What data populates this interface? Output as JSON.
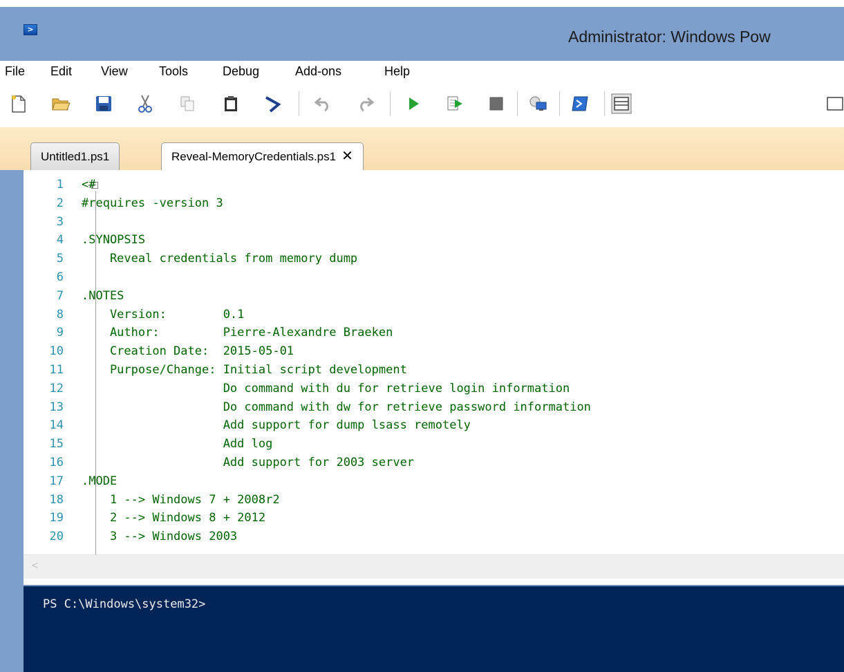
{
  "window": {
    "title": "Administrator: Windows Pow",
    "icon": "powershell-icon"
  },
  "menu": [
    "File",
    "Edit",
    "View",
    "Tools",
    "Debug",
    "Add-ons",
    "Help"
  ],
  "toolbar": {
    "icons": [
      "new-file-icon",
      "open-folder-icon",
      "save-icon",
      "cut-icon",
      "copy-icon",
      "paste-icon",
      "clear-console-icon",
      "undo-icon",
      "redo-icon",
      "run-script-icon",
      "run-selection-icon",
      "stop-icon",
      "remote-powershell-icon",
      "powershell-console-icon",
      "show-script-pane-top-icon",
      "show-script-pane-right-icon"
    ]
  },
  "tabs": [
    {
      "label": "Untitled1.ps1",
      "active": false
    },
    {
      "label": "Reveal-MemoryCredentials.ps1",
      "active": true,
      "close": "✕"
    }
  ],
  "editor": {
    "fold_marker": "−",
    "lines": [
      {
        "no": "1",
        "text": "<#"
      },
      {
        "no": "2",
        "text": "#requires -version 3"
      },
      {
        "no": "3",
        "text": ""
      },
      {
        "no": "4",
        "text": ".SYNOPSIS"
      },
      {
        "no": "5",
        "text": "    Reveal credentials from memory dump"
      },
      {
        "no": "6",
        "text": ""
      },
      {
        "no": "7",
        "text": ".NOTES"
      },
      {
        "no": "8",
        "text": "    Version:        0.1"
      },
      {
        "no": "9",
        "text": "    Author:         Pierre-Alexandre Braeken"
      },
      {
        "no": "10",
        "text": "    Creation Date:  2015-05-01"
      },
      {
        "no": "11",
        "text": "    Purpose/Change: Initial script development"
      },
      {
        "no": "12",
        "text": "                    Do command with du for retrieve login information"
      },
      {
        "no": "13",
        "text": "                    Do command with dw for retrieve password information"
      },
      {
        "no": "14",
        "text": "                    Add support for dump lsass remotely"
      },
      {
        "no": "15",
        "text": "                    Add log"
      },
      {
        "no": "16",
        "text": "                    Add support for 2003 server"
      },
      {
        "no": "17",
        "text": ".MODE"
      },
      {
        "no": "18",
        "text": "    1 --> Windows 7 + 2008r2"
      },
      {
        "no": "19",
        "text": "    2 --> Windows 8 + 2012"
      },
      {
        "no": "20",
        "text": "    3 --> Windows 2003"
      }
    ]
  },
  "scrollbar": {
    "left_arrow": "<"
  },
  "console": {
    "prompt": "PS C:\\Windows\\system32>"
  }
}
